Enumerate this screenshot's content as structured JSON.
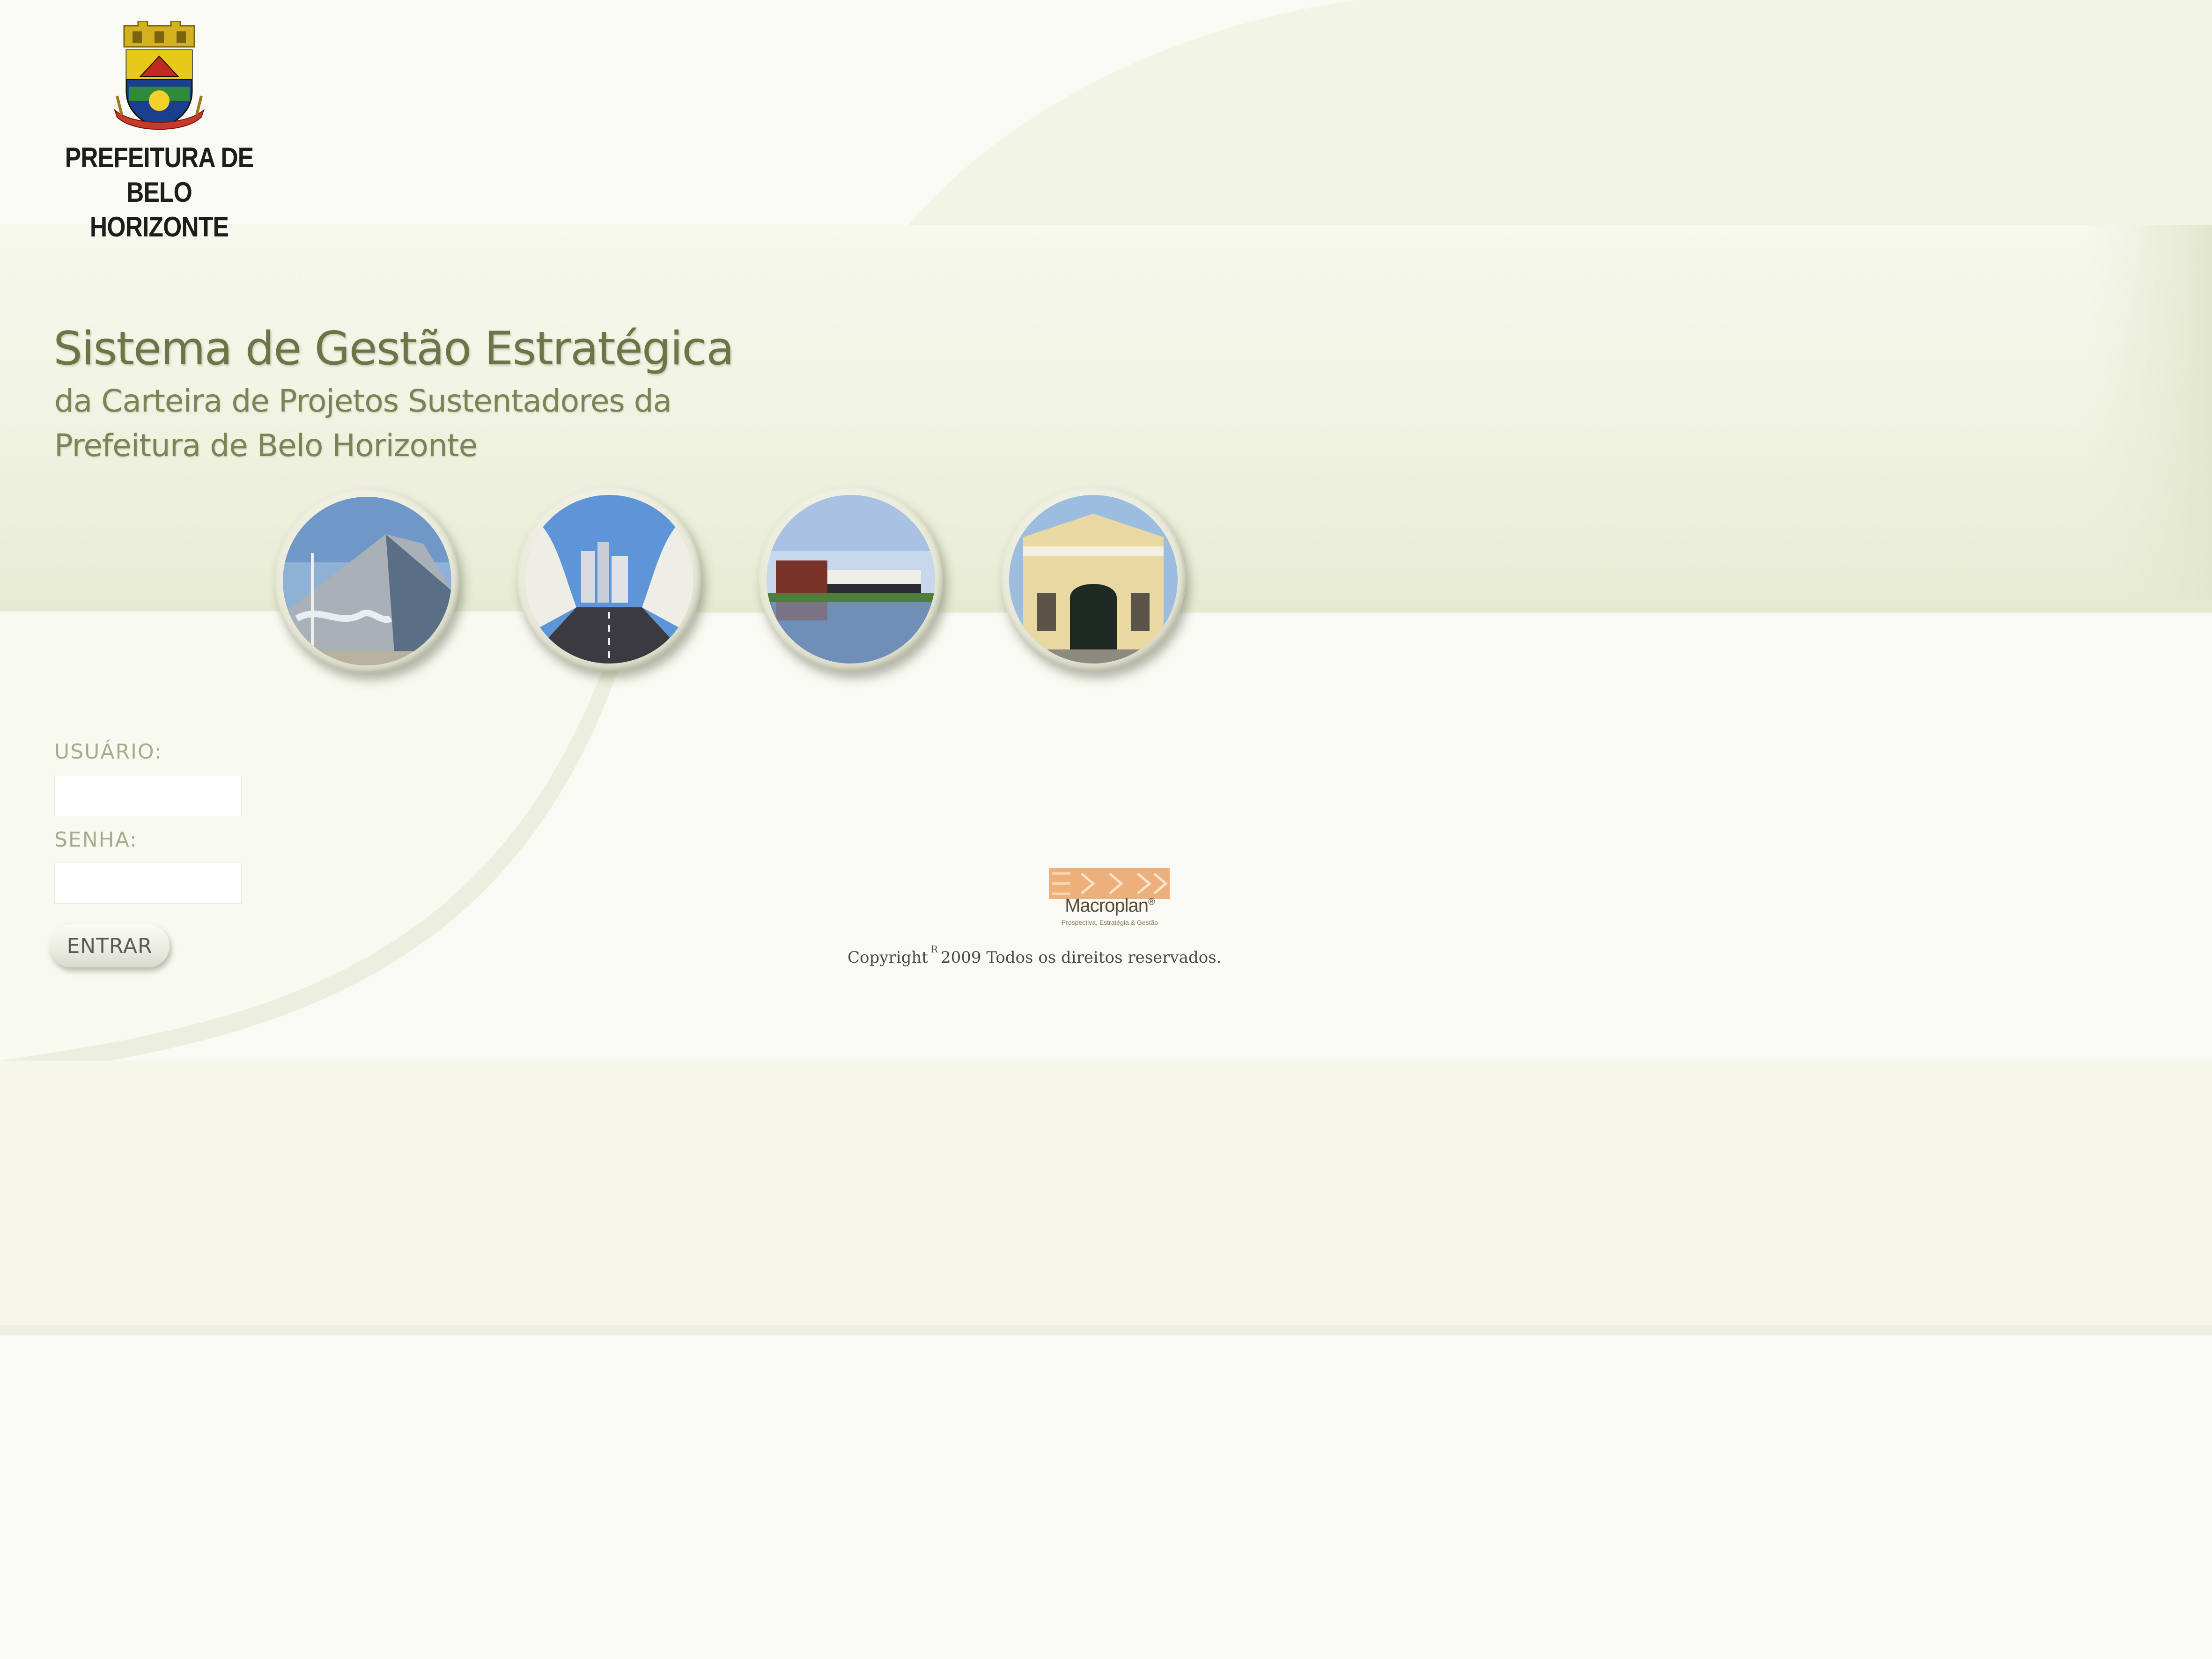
{
  "header": {
    "org_name_line1": "PREFEITURA DE",
    "org_name_line2": "BELO HORIZONTE"
  },
  "main": {
    "title": "Sistema de Gestão Estratégica",
    "subtitle_line1": "da Carteira de Projetos Sustentadores da",
    "subtitle_line2": "Prefeitura de Belo Horizonte"
  },
  "photos": [
    {
      "icon": "pampulha-church-photo"
    },
    {
      "icon": "viaduct-bridge-photo"
    },
    {
      "icon": "lagoon-building-photo"
    },
    {
      "icon": "historic-building-facade-photo"
    }
  ],
  "login": {
    "user_label": "USUÁRIO:",
    "user_value": "",
    "password_label": "SENHA:",
    "password_value": "",
    "submit_label": "ENTRAR"
  },
  "footer": {
    "brand_name": "Macroplan",
    "brand_mark": "®",
    "brand_tagline": "Prospectiva, Estratégia & Gestão",
    "copyright_prefix": "Copyright",
    "copyright_symbol": "R",
    "copyright_suffix": "2009 Todos os direitos reservados."
  },
  "colors": {
    "background": "#f9faf3",
    "title": "#6d7548",
    "label": "#a8ab8c",
    "macroplan_orange": "#e8a66c"
  }
}
